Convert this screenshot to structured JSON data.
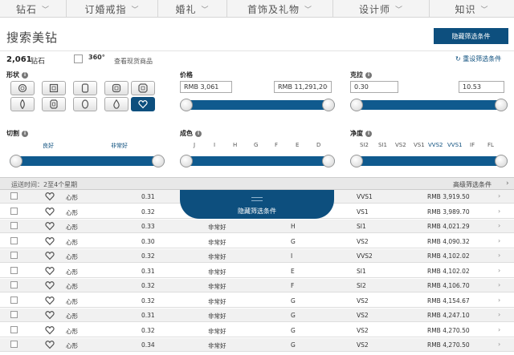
{
  "nav": [
    {
      "label": "钻石"
    },
    {
      "label": "订婚戒指"
    },
    {
      "label": "婚礼"
    },
    {
      "label": "首饰及礼物"
    },
    {
      "label": "设计师"
    },
    {
      "label": "知识"
    }
  ],
  "page": {
    "title": "搜索美钻",
    "hide_filters_label": "隐藏筛选条件",
    "count": "2,061",
    "count_label": "钻石",
    "view_stock_label": "查看现货商品",
    "icon360_label": "360°",
    "reset_label": "重设筛选条件"
  },
  "filters": {
    "shape_label": "形状",
    "price_label": "价格",
    "carat_label": "克拉",
    "cut_label": "切割",
    "color_label": "成色",
    "clarity_label": "净度",
    "shapes": [
      "round-icon",
      "princess-icon",
      "cushion-icon",
      "asscher-icon",
      "radiant-icon",
      "marquise-icon",
      "emerald-icon",
      "oval-icon",
      "pear-icon",
      "heart-icon"
    ],
    "selected_shape": "heart",
    "price_min": "RMB 3,061",
    "price_max": "RMB 11,291,200",
    "carat_min": "0.30",
    "carat_max": "10.53",
    "cut_ticks": [
      "良好",
      "非常好"
    ],
    "color_ticks": [
      "J",
      "I",
      "H",
      "G",
      "F",
      "E",
      "D"
    ],
    "clarity_ticks": [
      "SI2",
      "SI1",
      "VS2",
      "VS1",
      "VVS2",
      "VVS1",
      "IF",
      "FL"
    ]
  },
  "ship": {
    "text": "运送时间：2至4个星期",
    "advanced_label": "高级筛选条件"
  },
  "table": {
    "rows": [
      {
        "shape": "心形",
        "carat": "0.31",
        "cut": "",
        "color": "",
        "clarity": "VVS1",
        "price": "RMB 3,919.50"
      },
      {
        "shape": "心形",
        "carat": "0.32",
        "cut": "",
        "color": "",
        "clarity": "VS1",
        "price": "RMB 3,989.70"
      },
      {
        "shape": "心形",
        "carat": "0.33",
        "cut": "非常好",
        "color": "H",
        "clarity": "SI1",
        "price": "RMB 4,021.29"
      },
      {
        "shape": "心形",
        "carat": "0.30",
        "cut": "非常好",
        "color": "G",
        "clarity": "VS2",
        "price": "RMB 4,090.32"
      },
      {
        "shape": "心形",
        "carat": "0.32",
        "cut": "非常好",
        "color": "I",
        "clarity": "VVS2",
        "price": "RMB 4,102.02"
      },
      {
        "shape": "心形",
        "carat": "0.31",
        "cut": "非常好",
        "color": "E",
        "clarity": "SI1",
        "price": "RMB 4,102.02"
      },
      {
        "shape": "心形",
        "carat": "0.32",
        "cut": "非常好",
        "color": "F",
        "clarity": "SI2",
        "price": "RMB 4,106.70"
      },
      {
        "shape": "心形",
        "carat": "0.32",
        "cut": "非常好",
        "color": "G",
        "clarity": "VS2",
        "price": "RMB 4,154.67"
      },
      {
        "shape": "心形",
        "carat": "0.31",
        "cut": "非常好",
        "color": "G",
        "clarity": "VS2",
        "price": "RMB 4,247.10"
      },
      {
        "shape": "心形",
        "carat": "0.32",
        "cut": "非常好",
        "color": "G",
        "clarity": "VS2",
        "price": "RMB 4,270.50"
      },
      {
        "shape": "心形",
        "carat": "0.34",
        "cut": "非常好",
        "color": "G",
        "clarity": "VS2",
        "price": "RMB 4,270.50"
      }
    ]
  },
  "colors": {
    "accent": "#0d4f7e",
    "slider": "#0f5a8e"
  }
}
